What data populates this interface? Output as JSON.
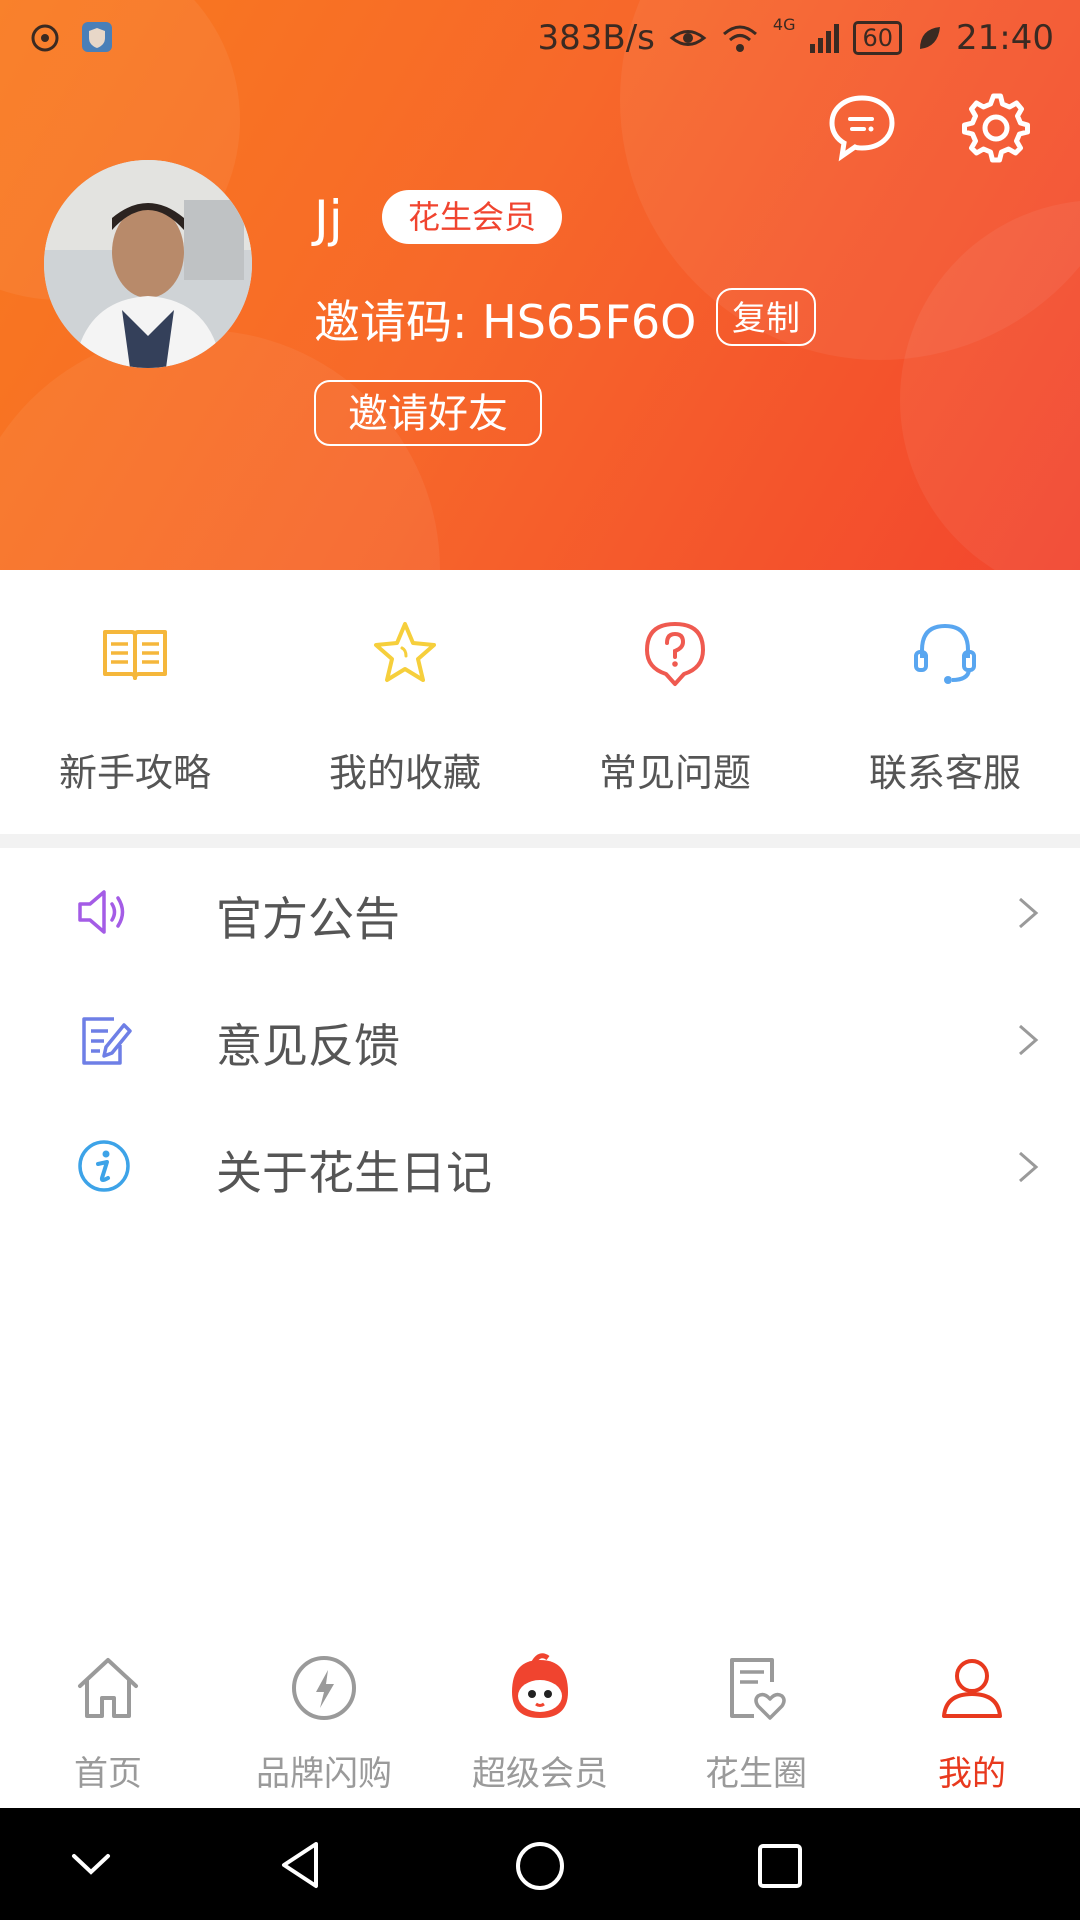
{
  "status_bar": {
    "net_speed": "383B/s",
    "network": "4G",
    "battery": "60",
    "time": "21:40"
  },
  "profile": {
    "username": "Jj",
    "member_badge": "花生会员",
    "invite_code_line": "邀请码: HS65F6O",
    "copy_label": "复制",
    "invite_friends_label": "邀请好友"
  },
  "quick_actions": [
    {
      "label": "新手攻略",
      "icon": "book-icon",
      "color": "#f5b73b"
    },
    {
      "label": "我的收藏",
      "icon": "star-icon",
      "color": "#f6cf3c"
    },
    {
      "label": "常见问题",
      "icon": "question-icon",
      "color": "#ef5a50"
    },
    {
      "label": "联系客服",
      "icon": "headset-icon",
      "color": "#59a6f0"
    }
  ],
  "menu": [
    {
      "label": "官方公告",
      "icon": "speaker-icon",
      "color": "#a45ce6"
    },
    {
      "label": "意见反馈",
      "icon": "feedback-icon",
      "color": "#6e7fe6"
    },
    {
      "label": "关于花生日记",
      "icon": "info-icon",
      "color": "#3da3e8"
    }
  ],
  "tabs": [
    {
      "label": "首页",
      "icon": "home-icon"
    },
    {
      "label": "品牌闪购",
      "icon": "lightning-icon"
    },
    {
      "label": "超级会员",
      "icon": "mascot-icon"
    },
    {
      "label": "花生圈",
      "icon": "heart-note-icon"
    },
    {
      "label": "我的",
      "icon": "user-icon",
      "active": true
    }
  ],
  "colors": {
    "header_start": "#f97a1e",
    "header_end": "#f2452e",
    "accent": "#e8391e"
  }
}
